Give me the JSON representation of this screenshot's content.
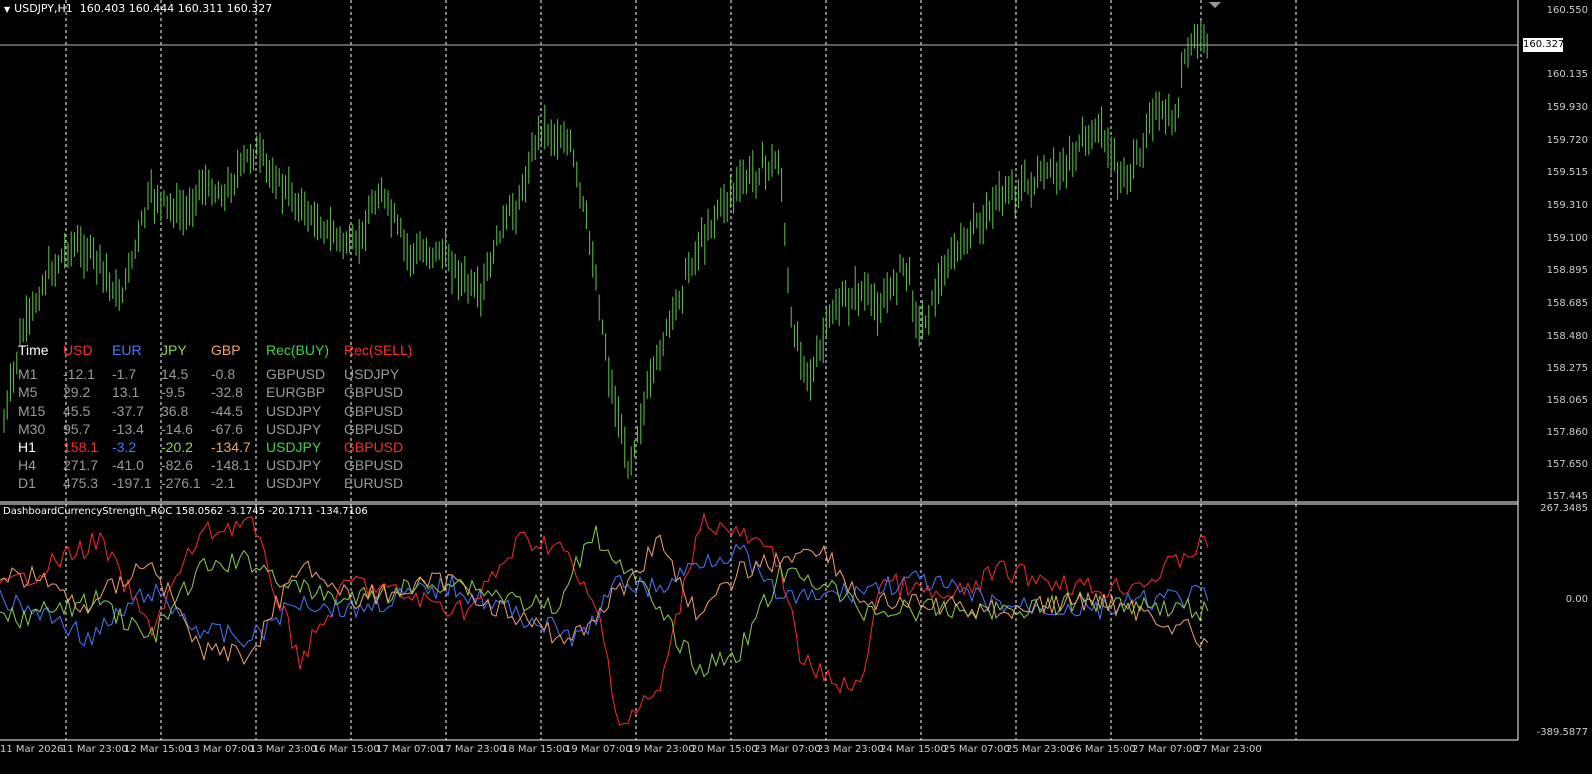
{
  "symbol_header": {
    "symbol": "USDJPY,H1",
    "values": "160.403 160.444 160.311 160.327"
  },
  "indicator_header": {
    "text": "DashboardCurrencyStrength_ROC 158.0562 -3.1745 -20.1711 -134.7106"
  },
  "current_price": "160.327",
  "colors": {
    "background": "#000000",
    "candle": "#5fc84a",
    "usd": "#ff2a2a",
    "eur": "#4a79ff",
    "jpy": "#8bd34d",
    "gbp": "#f4a36a",
    "rec_buy": "#3fd44a",
    "rec_sell": "#ff2a2a",
    "dim_text": "#9a9a9a",
    "grid": "#ffffff"
  },
  "price_axis": [
    "160.550",
    "160.135",
    "159.930",
    "159.720",
    "159.515",
    "159.310",
    "159.100",
    "158.895",
    "158.685",
    "158.480",
    "158.275",
    "158.065",
    "157.860",
    "157.650",
    "157.445"
  ],
  "indicator_axis": [
    "267.3485",
    "0.00",
    "-389.5877"
  ],
  "time_axis": [
    "11 Mar 2026",
    "11 Mar 23:00",
    "12 Mar 15:00",
    "13 Mar 07:00",
    "13 Mar 23:00",
    "16 Mar 15:00",
    "17 Mar 07:00",
    "17 Mar 23:00",
    "18 Mar 15:00",
    "19 Mar 07:00",
    "19 Mar 23:00",
    "20 Mar 15:00",
    "23 Mar 07:00",
    "23 Mar 23:00",
    "24 Mar 15:00",
    "25 Mar 07:00",
    "25 Mar 23:00",
    "26 Mar 15:00",
    "27 Mar 07:00",
    "27 Mar 23:00"
  ],
  "dashboard": {
    "headers": [
      "Time",
      "USD",
      "EUR",
      "JPY",
      "GBP",
      "Rec(BUY)",
      "Rec(SELL)"
    ],
    "rows": [
      {
        "tf": "M1",
        "usd": "-12.1",
        "eur": "-1.7",
        "jpy": "14.5",
        "gbp": "-0.8",
        "buy": "GBPUSD",
        "sell": "USDJPY",
        "highlight": false
      },
      {
        "tf": "M5",
        "usd": "29.2",
        "eur": "13.1",
        "jpy": "-9.5",
        "gbp": "-32.8",
        "buy": "EURGBP",
        "sell": "GBPUSD",
        "highlight": false
      },
      {
        "tf": "M15",
        "usd": "45.5",
        "eur": "-37.7",
        "jpy": "36.8",
        "gbp": "-44.5",
        "buy": "USDJPY",
        "sell": "GBPUSD",
        "highlight": false
      },
      {
        "tf": "M30",
        "usd": "95.7",
        "eur": "-13.4",
        "jpy": "-14.6",
        "gbp": "-67.6",
        "buy": "USDJPY",
        "sell": "GBPUSD",
        "highlight": false
      },
      {
        "tf": "H1",
        "usd": "158.1",
        "eur": "-3.2",
        "jpy": "-20.2",
        "gbp": "-134.7",
        "buy": "USDJPY",
        "sell": "GBPUSD",
        "highlight": true
      },
      {
        "tf": "H4",
        "usd": "271.7",
        "eur": "-41.0",
        "jpy": "-82.6",
        "gbp": "-148.1",
        "buy": "USDJPY",
        "sell": "GBPUSD",
        "highlight": false
      },
      {
        "tf": "D1",
        "usd": "475.3",
        "eur": "-197.1",
        "jpy": "-276.1",
        "gbp": "-2.1",
        "buy": "USDJPY",
        "sell": "EURUSD",
        "highlight": false
      }
    ]
  }
}
